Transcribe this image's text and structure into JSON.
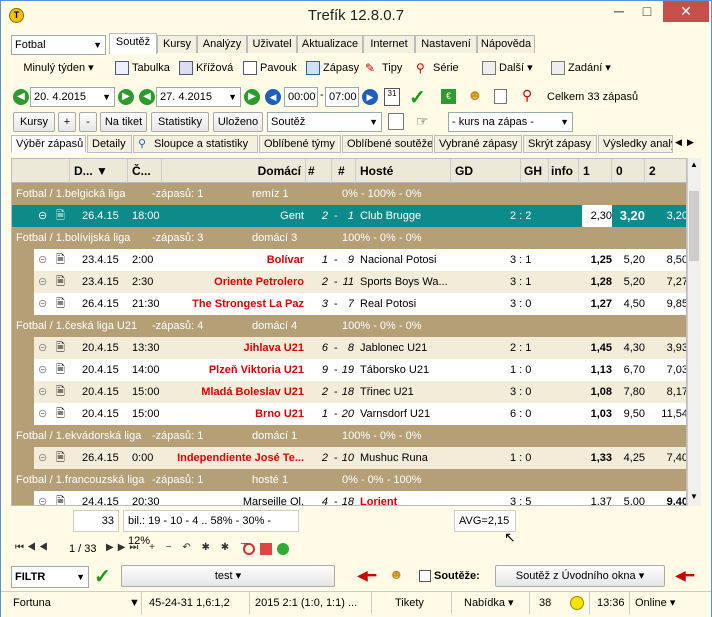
{
  "window": {
    "title": "Trefík 12.8.0.7",
    "min": "─",
    "max": "□",
    "close": "✕"
  },
  "sport": "Fotbal",
  "period": "Minulý týden",
  "tabs": [
    "Soutěž",
    "Kursy",
    "Analýzy",
    "Uživatel",
    "Aktualizace",
    "Internet",
    "Nastavení",
    "Nápověda"
  ],
  "tools": [
    "Tabulka",
    "Křížová",
    "Pavouk",
    "Zápasy",
    "Tipy",
    "Série",
    "Další",
    "Zadání"
  ],
  "date_from": "20.  4.2015",
  "date_to": "27.  4.2015",
  "time_from": "00:00",
  "time_to": "07:00",
  "total": "Celkem 33 zápasů",
  "btns": {
    "kursy": "Kursy",
    "plus": "+",
    "minus": "-",
    "na_tiket": "Na tiket",
    "statistiky": "Statistiky",
    "ulozeno": "Uloženo",
    "soutez": "Soutěž",
    "kurs": "- kurs na zápas -"
  },
  "subtabs": [
    "Výběr zápasů",
    "Detaily",
    "Sloupce a statistiky",
    "Oblíbené týmy",
    "Oblíbené soutěže",
    "Vybrané zápasy",
    "Skrýt zápasy",
    "Výsledky analýz"
  ],
  "headers": {
    "d": "D...",
    "c": "Č...",
    "home": "Domácí",
    "h1": "#",
    "h2": "#",
    "away": "Hosté",
    "gd": "GD",
    "gh": "GH",
    "info": "info",
    "o1": "1",
    "o0": "0",
    "o2": "2"
  },
  "groups": [
    {
      "name": "Fotbal / 1.belgická liga",
      "zapasu": "-zápasů: 1",
      "fav": "remíz 1",
      "pct": "0% - 100% - 0%"
    },
    {
      "name": "Fotbal / 1.bolívijská liga",
      "zapasu": "-zápasů: 3",
      "fav": "domácí 3",
      "pct": "100% - 0% - 0%"
    },
    {
      "name": "Fotbal / 1.česká liga U21",
      "zapasu": "-zápasů: 4",
      "fav": "domácí 4",
      "pct": "100% - 0% - 0%"
    },
    {
      "name": "Fotbal / 1.ekvádorská liga",
      "zapasu": "-zápasů: 1",
      "fav": "domácí 1",
      "pct": "100% - 0% - 0%"
    },
    {
      "name": "Fotbal / 1.francouzská liga",
      "zapasu": "-zápasů: 1",
      "fav": "hosté 1",
      "pct": "0% - 0% - 100%"
    }
  ],
  "matches": [
    {
      "date": "26.4.15",
      "time": "18:00",
      "home": "Gent",
      "hn": "2",
      "an": "1",
      "away": "Club Brugge",
      "score": "2 : 2",
      "o1": "2,30",
      "o0": "3,20",
      "o2": "3,20"
    },
    {
      "date": "23.4.15",
      "time": "2:00",
      "home": "Bolívar",
      "hn": "1",
      "an": "9",
      "away": "Nacional Potosi",
      "score": "3 : 1",
      "o1": "1,25",
      "o0": "5,20",
      "o2": "8,50"
    },
    {
      "date": "23.4.15",
      "time": "2:30",
      "home": "Oriente Petrolero",
      "hn": "2",
      "an": "11",
      "away": "Sports Boys Wa...",
      "score": "3 : 1",
      "o1": "1,28",
      "o0": "5,20",
      "o2": "7,27"
    },
    {
      "date": "26.4.15",
      "time": "21:30",
      "home": "The Strongest La Paz",
      "hn": "3",
      "an": "7",
      "away": "Real Potosi",
      "score": "3 : 0",
      "o1": "1,27",
      "o0": "4,50",
      "o2": "9,85"
    },
    {
      "date": "20.4.15",
      "time": "13:30",
      "home": "Jihlava U21",
      "hn": "6",
      "an": "8",
      "away": "Jablonec U21",
      "score": "2 : 1",
      "o1": "1,45",
      "o0": "4,30",
      "o2": "3,93"
    },
    {
      "date": "20.4.15",
      "time": "14:00",
      "home": "Plzeň Viktoria U21",
      "hn": "9",
      "an": "19",
      "away": "Táborsko U21",
      "score": "1 : 0",
      "o1": "1,13",
      "o0": "6,70",
      "o2": "7,03"
    },
    {
      "date": "20.4.15",
      "time": "15:00",
      "home": "Mladá Boleslav U21",
      "hn": "2",
      "an": "18",
      "away": "Třinec U21",
      "score": "3 : 0",
      "o1": "1,08",
      "o0": "7,80",
      "o2": "8,17"
    },
    {
      "date": "20.4.15",
      "time": "15:00",
      "home": "Brno U21",
      "hn": "1",
      "an": "20",
      "away": "Varnsdorf U21",
      "score": "6 : 0",
      "o1": "1,03",
      "o0": "9,50",
      "o2": "11,54"
    },
    {
      "date": "26.4.15",
      "time": "0:00",
      "home": "Independiente José Te...",
      "hn": "2",
      "an": "10",
      "away": "Mushuc Runa",
      "score": "1 : 0",
      "o1": "1,33",
      "o0": "4,25",
      "o2": "7,40"
    },
    {
      "date": "24.4.15",
      "time": "20:30",
      "home": "Marseille Ol.",
      "hn": "4",
      "an": "18",
      "away": "Lorient",
      "score": "3 : 5",
      "o1": "1,37",
      "o0": "5,00",
      "o2": "9,40"
    }
  ],
  "footer": {
    "count": "33",
    "bil": "bil.: 19 - 10 - 4 .. 58% - 30% - 12%",
    "avg": "AVG=2,15",
    "nav": "1 / 33"
  },
  "filter": {
    "label": "FILTR",
    "test": "test",
    "soutezo": "Soutěže:",
    "soutez_okno": "Soutěž z Úvodního okna"
  },
  "status": {
    "bookie": "Fortuna",
    "stats": "45-24-31  1,6:1,2",
    "season": "2015 2:1 (1:0, 1:1) ...",
    "tikety": "Tikety",
    "nabidka": "Nabídka",
    "n": "38",
    "time": "13:36",
    "online": "Online"
  }
}
